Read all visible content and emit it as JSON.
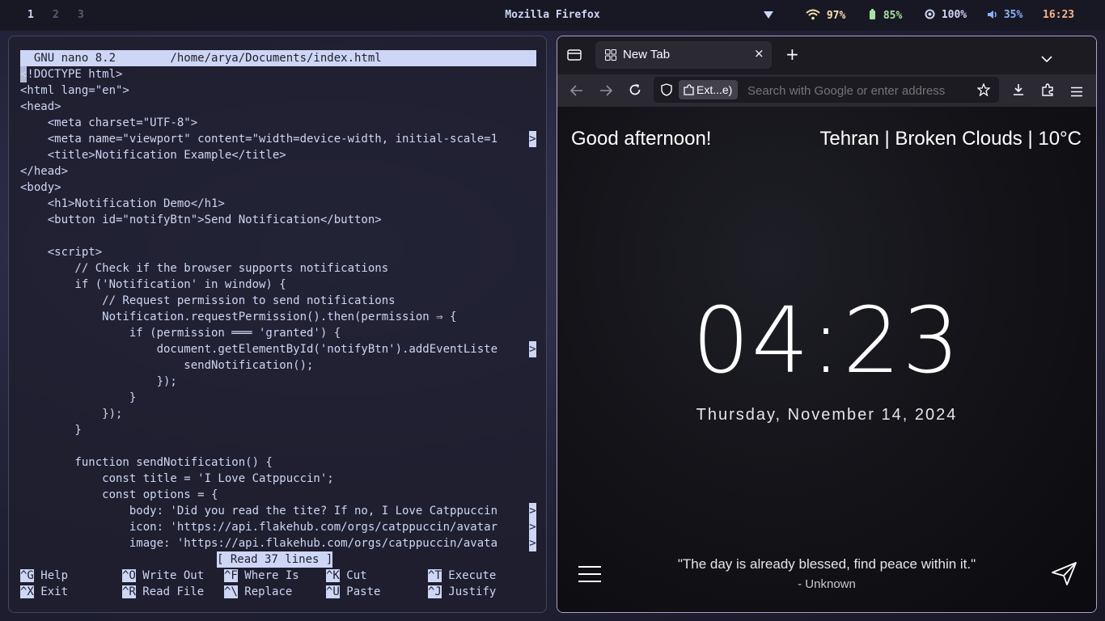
{
  "topbar": {
    "workspaces": [
      "1",
      "2",
      "3"
    ],
    "active_window_title": "Mozilla Firefox",
    "wifi": "97%",
    "battery": "85%",
    "brightness": "100%",
    "volume": "35%",
    "clock": "16:23"
  },
  "nano": {
    "header": "  GNU nano 8.2        /home/arya/Documents/index.html",
    "lines": [
      "<!DOCTYPE html>",
      "<html lang=\"en\">",
      "<head>",
      "    <meta charset=\"UTF-8\">",
      "    <meta name=\"viewport\" content=\"width=device-width, initial-scale=1",
      "    <title>Notification Example</title>",
      "</head>",
      "<body>",
      "    <h1>Notification Demo</h1>",
      "    <button id=\"notifyBtn\">Send Notification</button>",
      "",
      "    <script>",
      "        // Check if the browser supports notifications",
      "        if ('Notification' in window) {",
      "            // Request permission to send notifications",
      "            Notification.requestPermission().then(permission ⇒ {",
      "                if (permission ═══ 'granted') {",
      "                    document.getElementById('notifyBtn').addEventListe",
      "                        sendNotification();",
      "                    });",
      "                }",
      "            });",
      "        }",
      "",
      "        function sendNotification() {",
      "            const title = 'I Love Catppuccin';",
      "            const options = {",
      "                body: 'Did you read the tite? If no, I Love Catppuccin",
      "                icon: 'https://api.flakehub.com/orgs/catppuccin/avatar",
      "                image: 'https://api.flakehub.com/orgs/catppuccin/avata"
    ],
    "truncation_marker": ">",
    "status": "[ Read 37 lines ]",
    "shortcuts": [
      {
        "key": "^G",
        "label": "Help"
      },
      {
        "key": "^O",
        "label": "Write Out"
      },
      {
        "key": "^F",
        "label": "Where Is"
      },
      {
        "key": "^K",
        "label": "Cut"
      },
      {
        "key": "^T",
        "label": "Execute"
      },
      {
        "key": "^X",
        "label": "Exit"
      },
      {
        "key": "^R",
        "label": "Read File"
      },
      {
        "key": "^\\",
        "label": "Replace"
      },
      {
        "key": "^U",
        "label": "Paste"
      },
      {
        "key": "^J",
        "label": "Justify"
      }
    ]
  },
  "firefox": {
    "tab_title": "New Tab",
    "ext_chip": "Ext...e)",
    "url_placeholder": "Search with Google or enter address",
    "greeting": "Good afternoon!",
    "weather": "Tehran | Broken Clouds | 10°C",
    "time": "04:23",
    "date": "Thursday, November 14, 2024",
    "quote": "\"The day is already blessed, find peace within it.\"",
    "quote_author": "- Unknown"
  },
  "colors": {
    "bar_bg": "#181825",
    "text": "#cdd6f4",
    "wifi": "#f9e2af",
    "battery": "#a6e3a1",
    "volume": "#89b4fa",
    "clock": "#fab387"
  }
}
